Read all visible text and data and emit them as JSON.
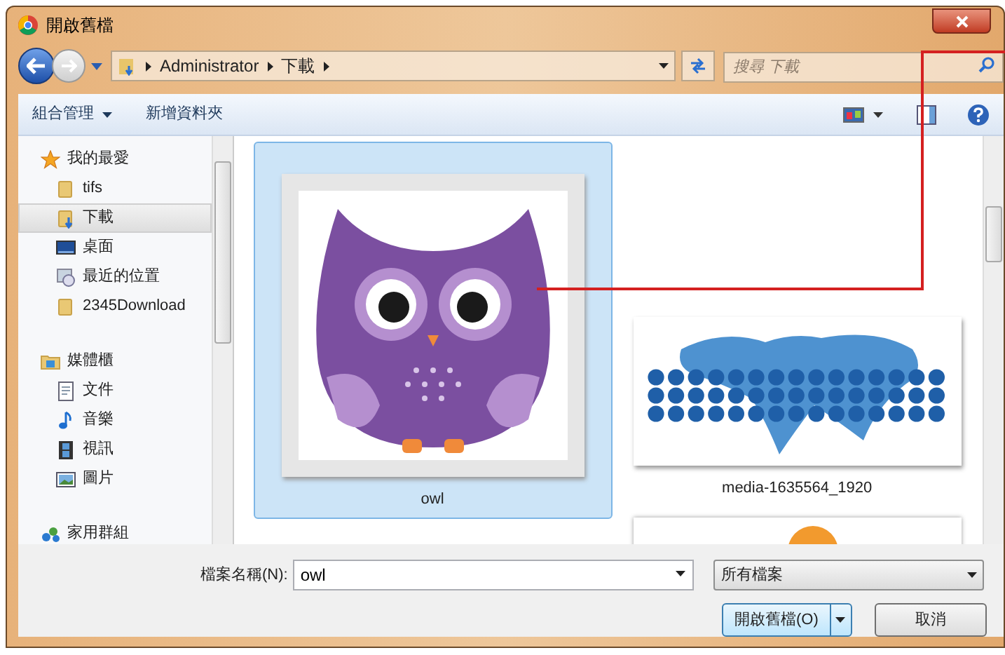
{
  "window": {
    "title": "開啟舊檔"
  },
  "address": {
    "crumbs": [
      "Administrator",
      "下載"
    ]
  },
  "search": {
    "placeholder": "搜尋 下載"
  },
  "toolbar": {
    "buttons": [
      {
        "label": "組合管理",
        "dropdown": true
      },
      {
        "label": "新增資料夾",
        "dropdown": false
      }
    ]
  },
  "sidebar": {
    "groups": [
      {
        "label": "我的最愛",
        "kind": "star",
        "items": [
          {
            "label": "tifs",
            "kind": "folder",
            "selected": false
          },
          {
            "label": "下載",
            "kind": "download",
            "selected": true
          },
          {
            "label": "桌面",
            "kind": "desktop",
            "selected": false
          },
          {
            "label": "最近的位置",
            "kind": "recent",
            "selected": false
          },
          {
            "label": "2345Download",
            "kind": "folder",
            "selected": false
          }
        ]
      },
      {
        "label": "媒體櫃",
        "kind": "library",
        "items": [
          {
            "label": "文件",
            "kind": "document",
            "selected": false
          },
          {
            "label": "音樂",
            "kind": "music",
            "selected": false
          },
          {
            "label": "視訊",
            "kind": "video",
            "selected": false
          },
          {
            "label": "圖片",
            "kind": "picture",
            "selected": false
          }
        ]
      },
      {
        "label": "家用群組",
        "kind": "homegroup"
      }
    ]
  },
  "files": [
    {
      "name": "owl",
      "kind": "owl",
      "selected": true
    },
    {
      "name": "media-1635564_1920",
      "kind": "map",
      "selected": false
    }
  ],
  "footer": {
    "filename_label": "檔案名稱(N):",
    "filename": "owl",
    "filetype": "所有檔案",
    "open": "開啟舊檔(O)",
    "cancel": "取消"
  }
}
